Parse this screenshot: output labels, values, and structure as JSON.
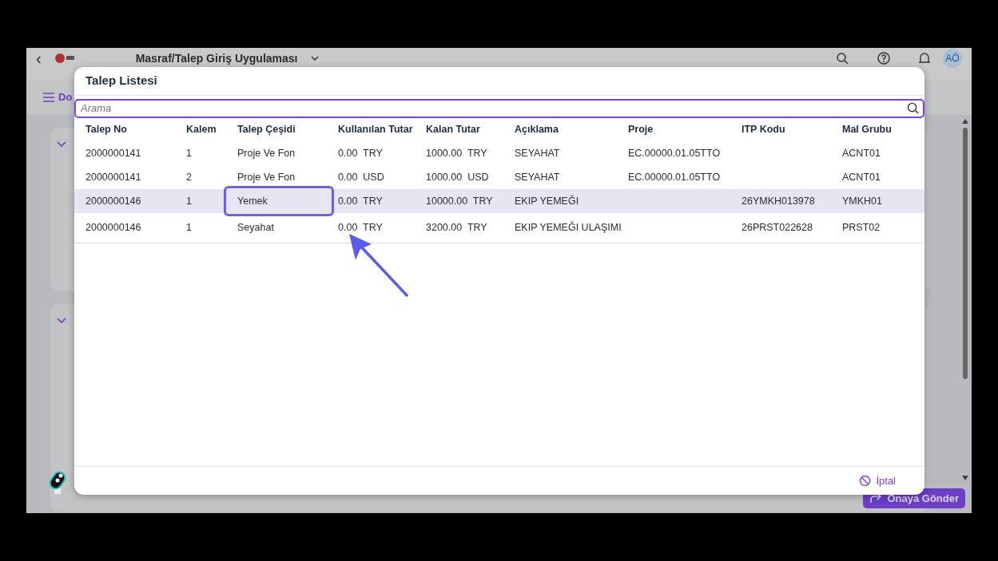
{
  "app_header": {
    "back": "‹",
    "title": "Masraf/Talep Giriş Uygulaması",
    "avatar": "AÖ"
  },
  "menu_button": {
    "label": "Do"
  },
  "dialog": {
    "title": "Talep Listesi",
    "search": {
      "placeholder": "Arama"
    },
    "columns": [
      "Talep No",
      "Kalem",
      "Talep Çeşidi",
      "Kullanılan Tutar",
      "Kalan Tutar",
      "Açıklama",
      "Proje",
      "ITP Kodu",
      "Mal Grubu"
    ],
    "rows": [
      {
        "selected": false,
        "annotated": false,
        "cells": [
          "2000000141",
          "1",
          "Proje Ve Fon",
          "0.00  TRY",
          "1000.00  TRY",
          "SEYAHAT",
          "EC.00000.01.05TTO",
          "",
          "ACNT01"
        ]
      },
      {
        "selected": false,
        "annotated": false,
        "cells": [
          "2000000141",
          "2",
          "Proje Ve Fon",
          "0.00  USD",
          "1000.00  USD",
          "SEYAHAT",
          "EC.00000.01.05TTO",
          "",
          "ACNT01"
        ]
      },
      {
        "selected": true,
        "annotated": true,
        "cells": [
          "2000000146",
          "1",
          "Yemek",
          "0.00  TRY",
          "10000.00  TRY",
          "EKIP YEMEĞI",
          "",
          "26YMKH013978",
          "YMKH01"
        ]
      },
      {
        "selected": false,
        "annotated": false,
        "cells": [
          "2000000146",
          "1",
          "Seyahat",
          "0.00  TRY",
          "3200.00  TRY",
          "EKIP YEMEĞI ULAŞIMI",
          "",
          "26PRST022628",
          "PRST02"
        ]
      }
    ],
    "cancel_button": "İptal"
  },
  "submit_button": "Onaya Gönder"
}
